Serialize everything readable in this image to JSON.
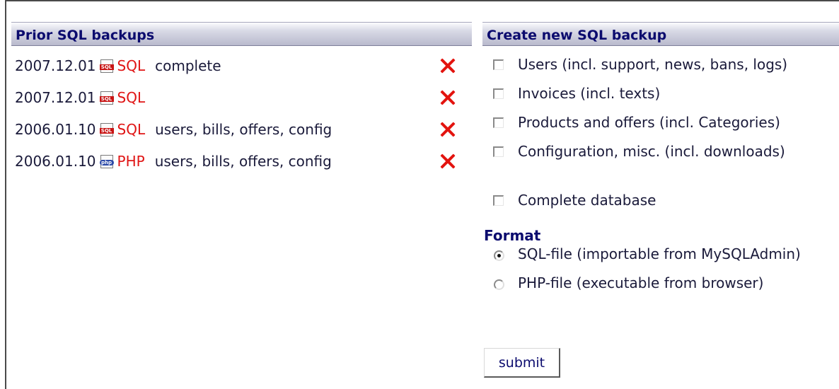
{
  "prior": {
    "header": "Prior SQL backups",
    "backups": [
      {
        "date": "2007.12.01",
        "icon": "sql-file-icon",
        "format": "SQL",
        "description": "complete"
      },
      {
        "date": "2007.12.01",
        "icon": "sql-file-icon",
        "format": "SQL",
        "description": ""
      },
      {
        "date": "2006.01.10",
        "icon": "sql-file-icon",
        "format": "SQL",
        "description": "users, bills, offers, config"
      },
      {
        "date": "2006.01.10",
        "icon": "php-file-icon",
        "format": "PHP",
        "description": "users, bills, offers, config"
      }
    ],
    "delete_icon": "delete-x-icon"
  },
  "create": {
    "header": "Create new SQL backup",
    "options": [
      {
        "label": "Users (incl. support, news, bans, logs)",
        "checked": false
      },
      {
        "label": "Invoices (incl. texts)",
        "checked": false
      },
      {
        "label": "Products and offers (incl. Categories)",
        "checked": false
      },
      {
        "label": "Configuration, misc. (incl. downloads)",
        "checked": false
      }
    ],
    "complete_db": {
      "label": "Complete database",
      "checked": false
    },
    "format_title": "Format",
    "formats": [
      {
        "label": "SQL-file (importable from MySQLAdmin)",
        "selected": true
      },
      {
        "label": "PHP-file (executable from browser)",
        "selected": false
      }
    ],
    "submit_label": "submit"
  },
  "colors": {
    "link_red": "#e01515",
    "header_text": "#0b0b6e",
    "delete_red": "#e3140f"
  }
}
